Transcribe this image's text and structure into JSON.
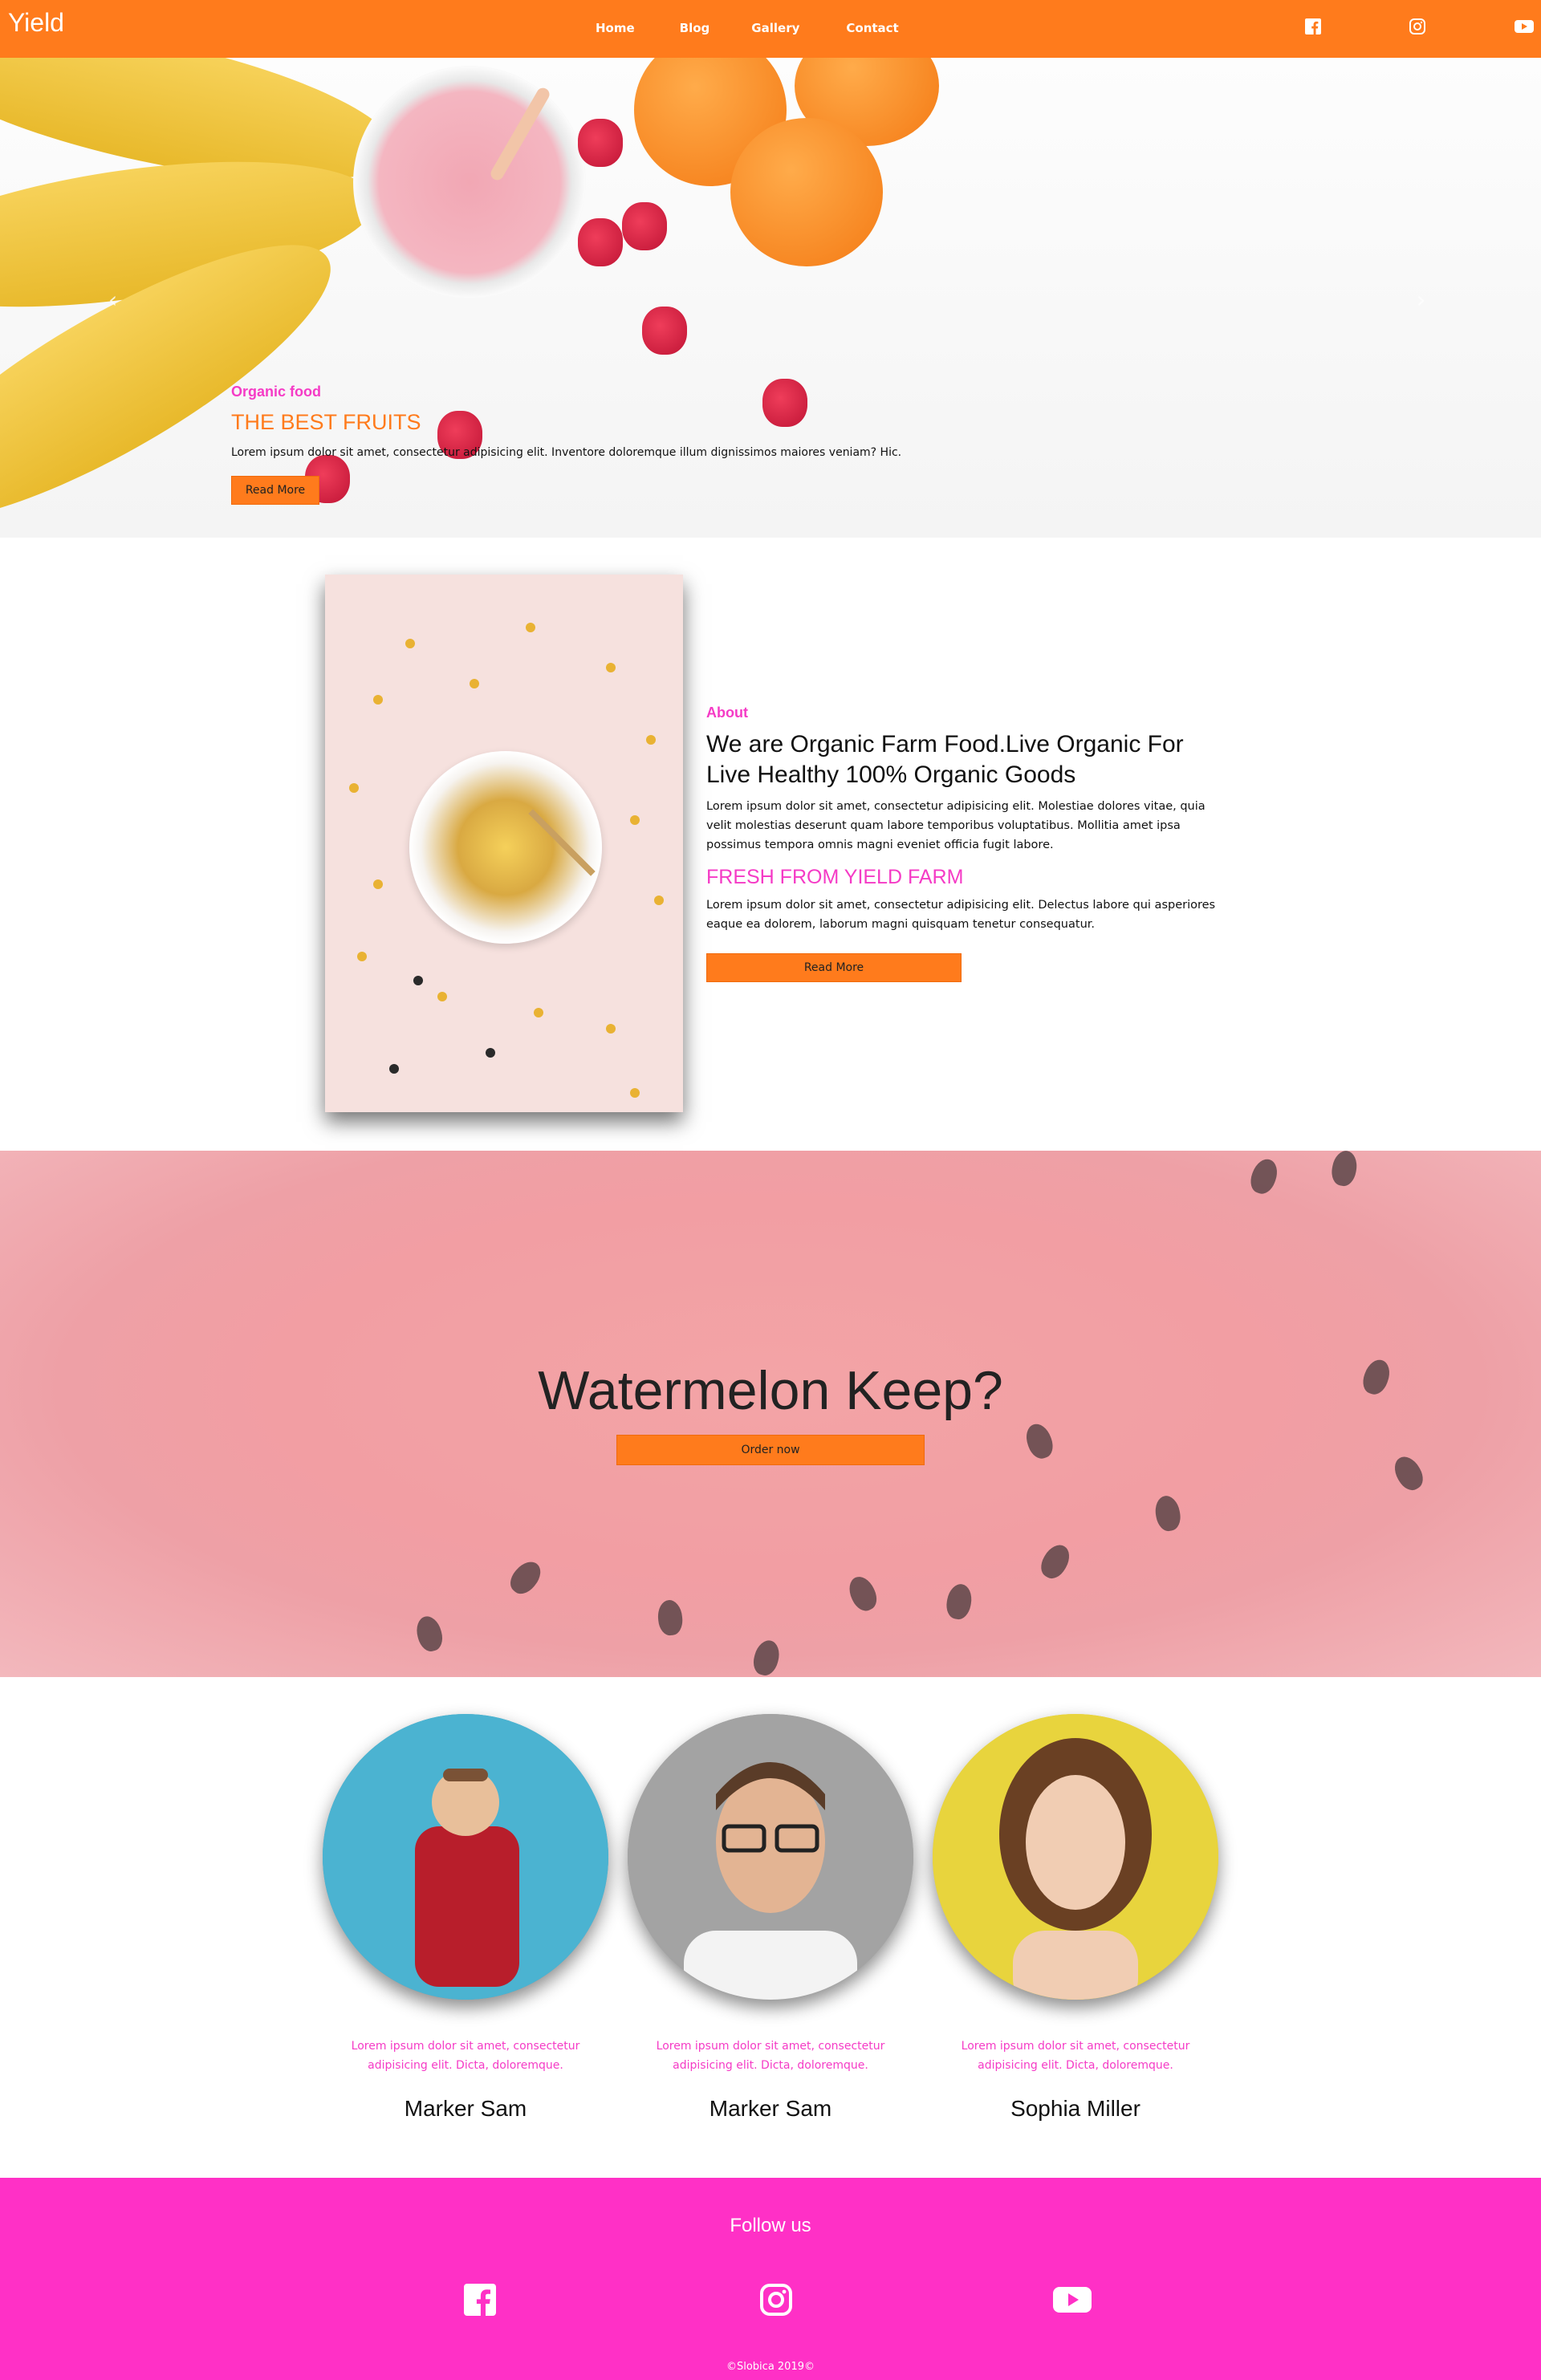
{
  "brand": "Yield",
  "nav": {
    "items": [
      "Home",
      "Blog",
      "Gallery",
      "Contact"
    ]
  },
  "social_icons": [
    "facebook-icon",
    "instagram-icon",
    "youtube-icon"
  ],
  "hero": {
    "eyebrow": "Organic food",
    "title": "THE BEST FRUITS",
    "description": "Lorem ipsum dolor sit amet, consectetur adipisicing elit. Inventore doloremque illum dignissimos maiores veniam? Hic.",
    "button": "Read More"
  },
  "about": {
    "eyebrow": "About",
    "title": "We are Organic Farm Food.Live Organic For Live Healthy 100% Organic Goods",
    "paragraph1": "Lorem ipsum dolor sit amet, consectetur adipisicing elit. Molestiae dolores vitae, quia velit molestias deserunt quam labore temporibus voluptatibus. Mollitia amet ipsa possimus tempora omnis magni eveniet officia fugit labore.",
    "subtitle": "FRESH FROM YIELD FARM",
    "paragraph2": "Lorem ipsum dolor sit amet, consectetur adipisicing elit. Delectus labore qui asperiores eaque ea dolorem, laborum magni quisquam tenetur consequatur.",
    "button": "Read More"
  },
  "promo": {
    "title": "Watermelon Keep?",
    "button": "Order now"
  },
  "team": [
    {
      "text": "Lorem ipsum dolor sit amet, consectetur adipisicing elit. Dicta, doloremque.",
      "name": "Marker Sam"
    },
    {
      "text": "Lorem ipsum dolor sit amet, consectetur adipisicing elit. Dicta, doloremque.",
      "name": "Marker Sam"
    },
    {
      "text": "Lorem ipsum dolor sit amet, consectetur adipisicing elit. Dicta, doloremque.",
      "name": "Sophia Miller"
    }
  ],
  "footer": {
    "follow": "Follow us",
    "copyright": "©Slobica 2019©"
  },
  "colors": {
    "accent_orange": "#ff7b1c",
    "accent_pink": "#f53bc6",
    "footer_pink": "#ff30c6"
  }
}
